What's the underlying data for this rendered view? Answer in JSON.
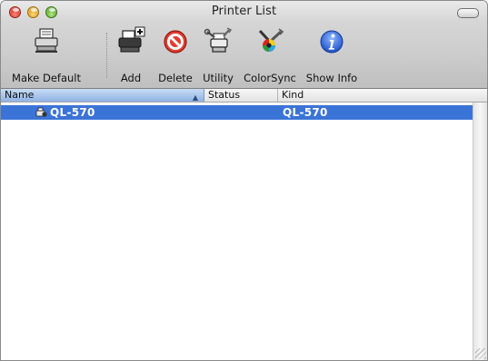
{
  "window": {
    "title": "Printer List",
    "controls": {
      "close_icon": "close-icon",
      "minimize_icon": "minimize-icon",
      "zoom_icon": "zoom-icon"
    }
  },
  "toolbar": {
    "buttons": [
      {
        "label": "Make Default",
        "icon": "printer-icon"
      },
      {
        "label": "Add",
        "icon": "add-printer-icon"
      },
      {
        "label": "Delete",
        "icon": "delete-icon"
      },
      {
        "label": "Utility",
        "icon": "utility-icon"
      },
      {
        "label": "ColorSync",
        "icon": "colorsync-icon"
      },
      {
        "label": "Show Info",
        "icon": "info-icon"
      }
    ]
  },
  "table": {
    "columns": [
      {
        "label": "Name",
        "sorted": true,
        "sort_direction": "ascending"
      },
      {
        "label": "Status"
      },
      {
        "label": "Kind"
      }
    ],
    "rows": [
      {
        "name": "QL-570",
        "status": "",
        "kind": "QL-570",
        "selected": true,
        "icon": "printer-row-icon"
      }
    ]
  },
  "colors": {
    "selection": "#3b74d7",
    "header_sorted": "#8fb3e4"
  }
}
